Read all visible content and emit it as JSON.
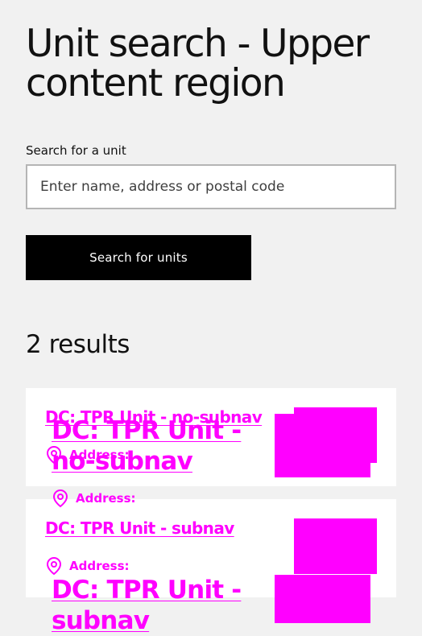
{
  "page": {
    "title": "Unit search - Upper content region"
  },
  "search": {
    "label": "Search for a unit",
    "placeholder": "Enter name, address or postal code",
    "value": "",
    "button_label": "Search for units"
  },
  "results": {
    "count_text": "2 results",
    "items": [
      {
        "title": "DC: TPR Unit - no-subnav",
        "address_label": "Address:"
      },
      {
        "title": "DC: TPR Unit - subnav",
        "address_label": "Address:"
      }
    ],
    "overlay_items": [
      {
        "title": "DC: TPR Unit - no-subnav",
        "address_label": "Address:"
      },
      {
        "title": "DC: TPR Unit - subnav",
        "address_label": "Address:"
      }
    ]
  },
  "colors": {
    "link": "#ff00ff",
    "button_bg": "#000000",
    "page_bg": "#f1f1f1"
  },
  "icons": [
    "location-pin-icon"
  ]
}
